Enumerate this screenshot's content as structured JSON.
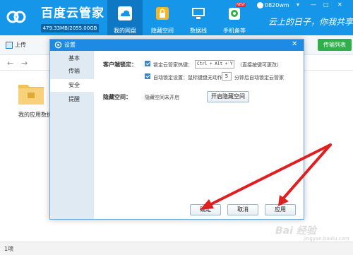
{
  "app": {
    "name": "百度云管家",
    "quota": "479.33MB/2055.00GB"
  },
  "nav": {
    "items": [
      {
        "label": "我的网盘",
        "icon": "cloud-icon"
      },
      {
        "label": "隐藏空间",
        "icon": "lock-icon"
      },
      {
        "label": "数据线",
        "icon": "monitor-icon"
      },
      {
        "label": "手机备等",
        "icon": "phone-icon",
        "badge": "NEW"
      }
    ]
  },
  "user": {
    "name": "0820wm"
  },
  "window_controls": {
    "skin": "▾",
    "minimize": "—",
    "maximize": "□",
    "close": "✕"
  },
  "slogan": "云上的日子，你我共享",
  "toolbar": {
    "upload": "上传",
    "sync": "传输列表"
  },
  "folder": {
    "label": "我的应用数据"
  },
  "statusbar": {
    "count": "1项"
  },
  "watermark": {
    "text": "Bai 经验",
    "url": "jingyan.baidu.com"
  },
  "dialog": {
    "title": "设置",
    "close": "✕",
    "sidebar": [
      "基本",
      "传输",
      "安全",
      "提醒"
    ],
    "active_index": 2,
    "client_lock_label": "客户端锁定：",
    "hotkey_label": "锁定云管家热键：",
    "hotkey_value": "Ctrl + Alt + Y",
    "hotkey_hint": "（直接按键可更改）",
    "autolock_label": "自动锁定设置：鼠标键盘无动作",
    "autolock_minutes": "5",
    "autolock_suffix": "分钟后自动锁定云管家",
    "hidden_space_label": "隐藏空间：",
    "hidden_space_status": "隐藏空间未开启",
    "hidden_space_button": "开启隐藏空间",
    "ok": "确定",
    "cancel": "取消",
    "apply": "应用"
  },
  "colors": {
    "header": "#1596e8",
    "dialog_title": "#1d8ae3",
    "annotation_arrow": "#e02020",
    "sync_green": "#2fb04a"
  }
}
